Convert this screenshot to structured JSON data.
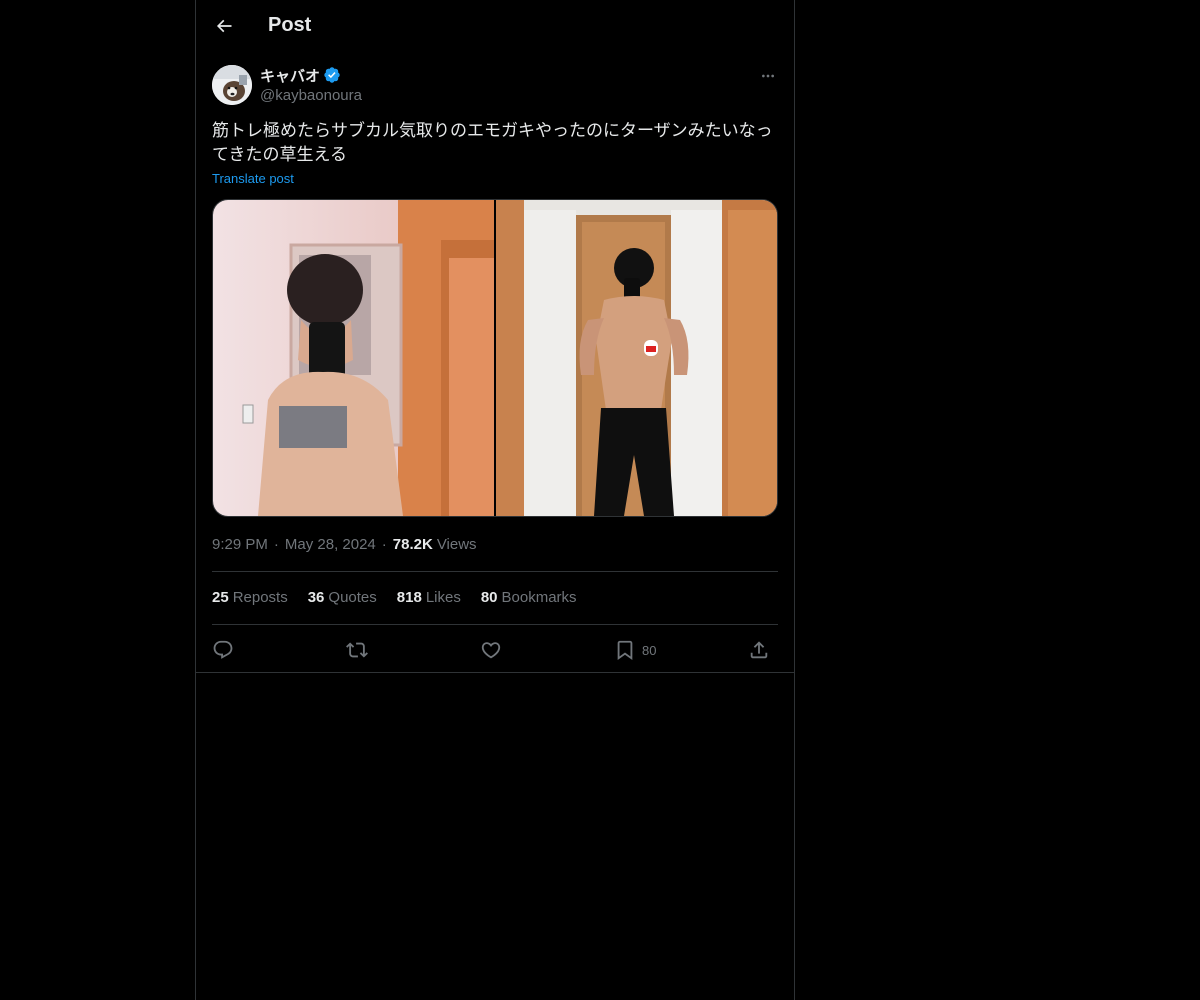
{
  "header": {
    "title": "Post",
    "back_icon": "arrow-left-icon"
  },
  "author": {
    "display_name": "キャバオ",
    "handle": "@kaybaonoura",
    "verified": true,
    "verified_color": "#1d9bf0"
  },
  "post": {
    "text": "筋トレ極めたらサブカル気取りのエモガキやったのにターザンみたいなってきたの草生える",
    "translate_label": "Translate post",
    "media_count": 2
  },
  "meta": {
    "time": "9:29 PM",
    "date": "May 28, 2024",
    "separator": "·",
    "views_count": "78.2K",
    "views_label": "Views"
  },
  "stats": [
    {
      "count": "25",
      "label": "Reposts"
    },
    {
      "count": "36",
      "label": "Quotes"
    },
    {
      "count": "818",
      "label": "Likes"
    },
    {
      "count": "80",
      "label": "Bookmarks"
    }
  ],
  "actions": {
    "reply_icon": "reply-icon",
    "repost_icon": "repost-icon",
    "like_icon": "heart-icon",
    "bookmark_icon": "bookmark-icon",
    "bookmark_count": "80",
    "share_icon": "share-icon"
  },
  "colors": {
    "background": "#000000",
    "text_primary": "#e7e9ea",
    "text_secondary": "#71767b",
    "accent": "#1d9bf0",
    "border": "#2f3336"
  }
}
